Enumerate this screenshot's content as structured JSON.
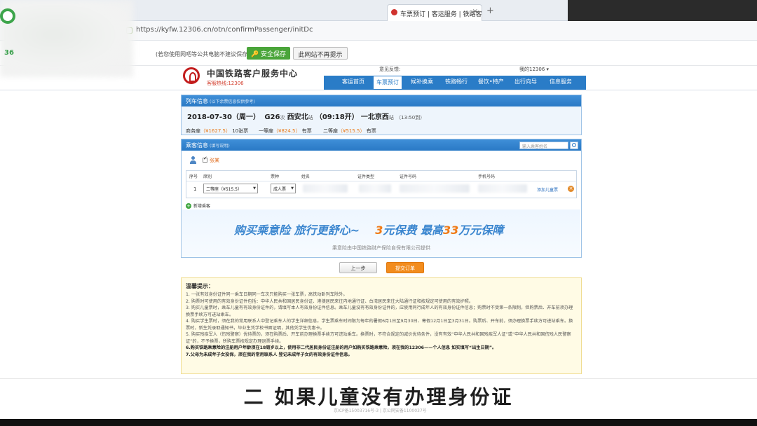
{
  "browser": {
    "tab_title": "车票预订 | 客运服务 | 铁路客户中",
    "new_tab": "+",
    "url": "https://kyfw.12306.cn/otn/confirmPassenger/initDc",
    "side_text": "36"
  },
  "notice_bar": {
    "text": "(若您使用网吧等公共电脑不建议保存)",
    "save_button": "安全保存",
    "no_prompt_button": "此网站不再提示"
  },
  "site": {
    "title": "中国铁路客户服务中心",
    "hotline": "客服热线:12306",
    "welcome": "意见反馈:",
    "my12306": "我的12306 ▾",
    "nav": [
      "客运首页",
      "车票预订",
      "候补换乘",
      "铁路畅行",
      "餐饮•特产",
      "出行向导",
      "信息服务"
    ],
    "nav_active_index": 1
  },
  "train_info": {
    "header": "列车信息",
    "header_hint": "(以下余票信息仅供参考)",
    "date": "2018-07-30（周一）",
    "train_no": "G26",
    "train_suffix": "次",
    "from": "西安北",
    "from_suffix": "站",
    "depart": "（09:18开）",
    "to": "一北京西",
    "to_suffix": "站",
    "arrive": "（13:50到）",
    "seats": [
      {
        "name": "商务座",
        "price": "（¥1627.5）",
        "avail": "10张票"
      },
      {
        "name": "一等座",
        "price": "（¥824.5）",
        "avail": "有票"
      },
      {
        "name": "二等座",
        "price": "（¥515.5）",
        "avail": "有票"
      }
    ]
  },
  "passenger_info": {
    "header": "乘客信息",
    "header_hint": "(填写说明)",
    "search_placeholder": "输入乘客姓名",
    "checked_name": "张某",
    "columns": [
      "序号",
      "席别",
      "票种",
      "姓名",
      "证件类型",
      "证件号码",
      "手机号码"
    ],
    "rows": [
      {
        "index": "1",
        "seat": "二等座（¥515.5）",
        "ticket_type": "成人票",
        "add_child": "添加儿童票"
      }
    ],
    "add_passenger": "新增乘客"
  },
  "insurance": {
    "slogan_a": "购买乘意险  旅行更舒心~",
    "slogan_b_pre": "3",
    "slogan_b_mid": "元保费  最高",
    "slogan_b_num": "33",
    "slogan_b_post": "万元保障",
    "provider": "乘意险由中国铁路财产保险自保有限公司提供"
  },
  "actions": {
    "prev": "上一步",
    "submit": "提交订单"
  },
  "tips": {
    "title": "温馨提示：",
    "items": [
      "1. 一张有效身份证件同一乘车日期同一车次只能购买一张车票，高铁动卧列车除外。",
      "2. 购票时可使用的有效身份证件包括：中华人民共和国居民身份证、港澳居民来往内地通行证、台湾居民来往大陆通行证和按规定可使用的有效护照。",
      "3. 购买儿童票时，乘车儿童有有效身份证件的，请填写本人有效身份证件信息。乘车儿童没有有效身份证件的，应使用同行成年人的有效身份证件信息；购票时不受第一条限制，但购票后、开车前须办理换票手续方可进站乘车。",
      "4. 购买学生票时，须在我的常用联系人中登记乘车人的学生详细信息。学生票乘车时间限为每年的暑假6月1日至9月30日、寒假12月1日至3月31日。购票后、开车前，须办理换票手续方可进站乘车。换票时，新生凭录取通知书，毕业生凭学校书面证明，其他凭学生优惠卡。",
      "5. 购买残疾军人（伤残警察）优待票的，须在购票后、开车前办理换票手续方可进站乘车。换票时，不符合规定的减价优待条件，没有有效“中华人民共和国残疾军人证”或“中华人民共和国伤残人民警察证”的，不予换票，所购车票按规定办理退票手续。",
      "6.购买铁路乘意险的注册用户年龄须在18周岁以上，使用非二代居民身份证注册的用户如购买铁路乘意险，须在我的12306——个人信息 如实填写“出生日期”。",
      "7.父母为未成年子女投保，须在我的常用联系人 登记未成年子女的有效身份证件信息。"
    ]
  },
  "footer": {
    "text": "京ICP备15003716号-3  |  京公网安备1100037号"
  },
  "subtitle": "二 如果儿童没有办理身份证"
}
